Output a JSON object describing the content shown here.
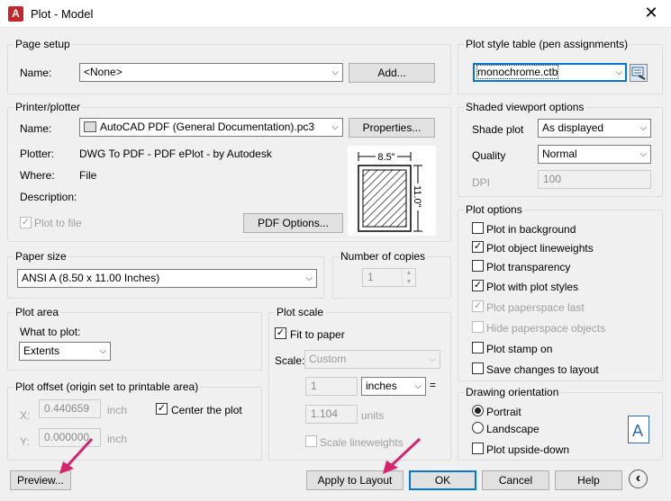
{
  "window": {
    "title": "Plot - Model",
    "app_icon": "A"
  },
  "page_setup": {
    "legend": "Page setup",
    "name_label": "Name:",
    "name_value": "<None>",
    "add_button": "Add..."
  },
  "printer": {
    "legend": "Printer/plotter",
    "name_label": "Name:",
    "name_value": "AutoCAD PDF (General Documentation).pc3",
    "properties_button": "Properties...",
    "plotter_label": "Plotter:",
    "plotter_value": "DWG To PDF - PDF ePlot - by Autodesk",
    "where_label": "Where:",
    "where_value": "File",
    "description_label": "Description:",
    "plot_to_file": "Plot to file",
    "pdf_options_button": "PDF Options...",
    "preview_width": "8.5\"",
    "preview_height": "11.0\""
  },
  "paper_size": {
    "legend": "Paper size",
    "value": "ANSI A (8.50 x 11.00 Inches)"
  },
  "copies": {
    "legend": "Number of copies",
    "value": "1"
  },
  "plot_area": {
    "legend": "Plot area",
    "what_label": "What to plot:",
    "what_value": "Extents"
  },
  "plot_offset": {
    "legend": "Plot offset (origin set to printable area)",
    "x_label": "X:",
    "x_value": "0.440659",
    "x_unit": "inch",
    "y_label": "Y:",
    "y_value": "0.000000",
    "y_unit": "inch",
    "center_label": "Center the plot"
  },
  "plot_scale": {
    "legend": "Plot scale",
    "fit_label": "Fit to paper",
    "scale_label": "Scale:",
    "scale_value": "Custom",
    "v1": "1",
    "unit1": "inches",
    "eq": "=",
    "v2": "1.104",
    "unit2": "units",
    "lineweights_label": "Scale lineweights"
  },
  "style_table": {
    "legend": "Plot style table (pen assignments)",
    "value": "monochrome.ctb"
  },
  "shaded": {
    "legend": "Shaded viewport options",
    "shade_label": "Shade plot",
    "shade_value": "As displayed",
    "quality_label": "Quality",
    "quality_value": "Normal",
    "dpi_label": "DPI",
    "dpi_value": "100"
  },
  "plot_options": {
    "legend": "Plot options",
    "items": [
      {
        "label": "Plot in background",
        "checked": ""
      },
      {
        "label": "Plot object lineweights",
        "checked": "✓"
      },
      {
        "label": "Plot transparency",
        "checked": ""
      },
      {
        "label": "Plot with plot styles",
        "checked": "✓"
      },
      {
        "label": "Plot paperspace last",
        "checked": "✓"
      },
      {
        "label": "Hide paperspace objects",
        "checked": ""
      },
      {
        "label": "Plot stamp on",
        "checked": ""
      },
      {
        "label": "Save changes to layout",
        "checked": ""
      }
    ]
  },
  "orientation": {
    "legend": "Drawing orientation",
    "portrait": "Portrait",
    "landscape": "Landscape",
    "upside_down": "Plot upside-down",
    "icon_letter": "A"
  },
  "buttons": {
    "preview": "Preview...",
    "apply": "Apply to Layout",
    "ok": "OK",
    "cancel": "Cancel",
    "help": "Help",
    "collapse": "‹"
  },
  "colors": {
    "accent": "#0078d7",
    "annotation_arrow": "#d6246e",
    "app_icon": "#c4262e"
  }
}
